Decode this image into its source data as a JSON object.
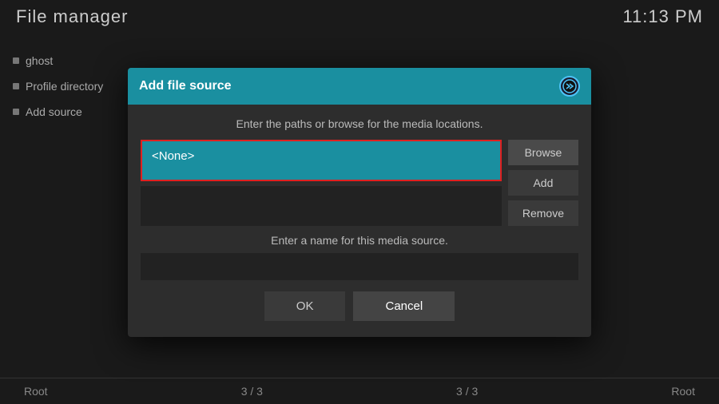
{
  "app": {
    "title": "File manager",
    "clock": "11:13 PM"
  },
  "sidebar": {
    "items": [
      {
        "label": "ghost"
      },
      {
        "label": "Profile directory"
      },
      {
        "label": "Add source"
      }
    ]
  },
  "bottom_bar": {
    "left": "Root",
    "center_left": "3 / 3",
    "center_right": "3 / 3",
    "right": "Root"
  },
  "dialog": {
    "title": "Add file source",
    "logo_text": "⊕",
    "instruction": "Enter the paths or browse for the media locations.",
    "path_placeholder": "<None>",
    "name_instruction": "Enter a name for this media source.",
    "buttons": {
      "browse": "Browse",
      "add": "Add",
      "remove": "Remove",
      "ok": "OK",
      "cancel": "Cancel"
    }
  }
}
